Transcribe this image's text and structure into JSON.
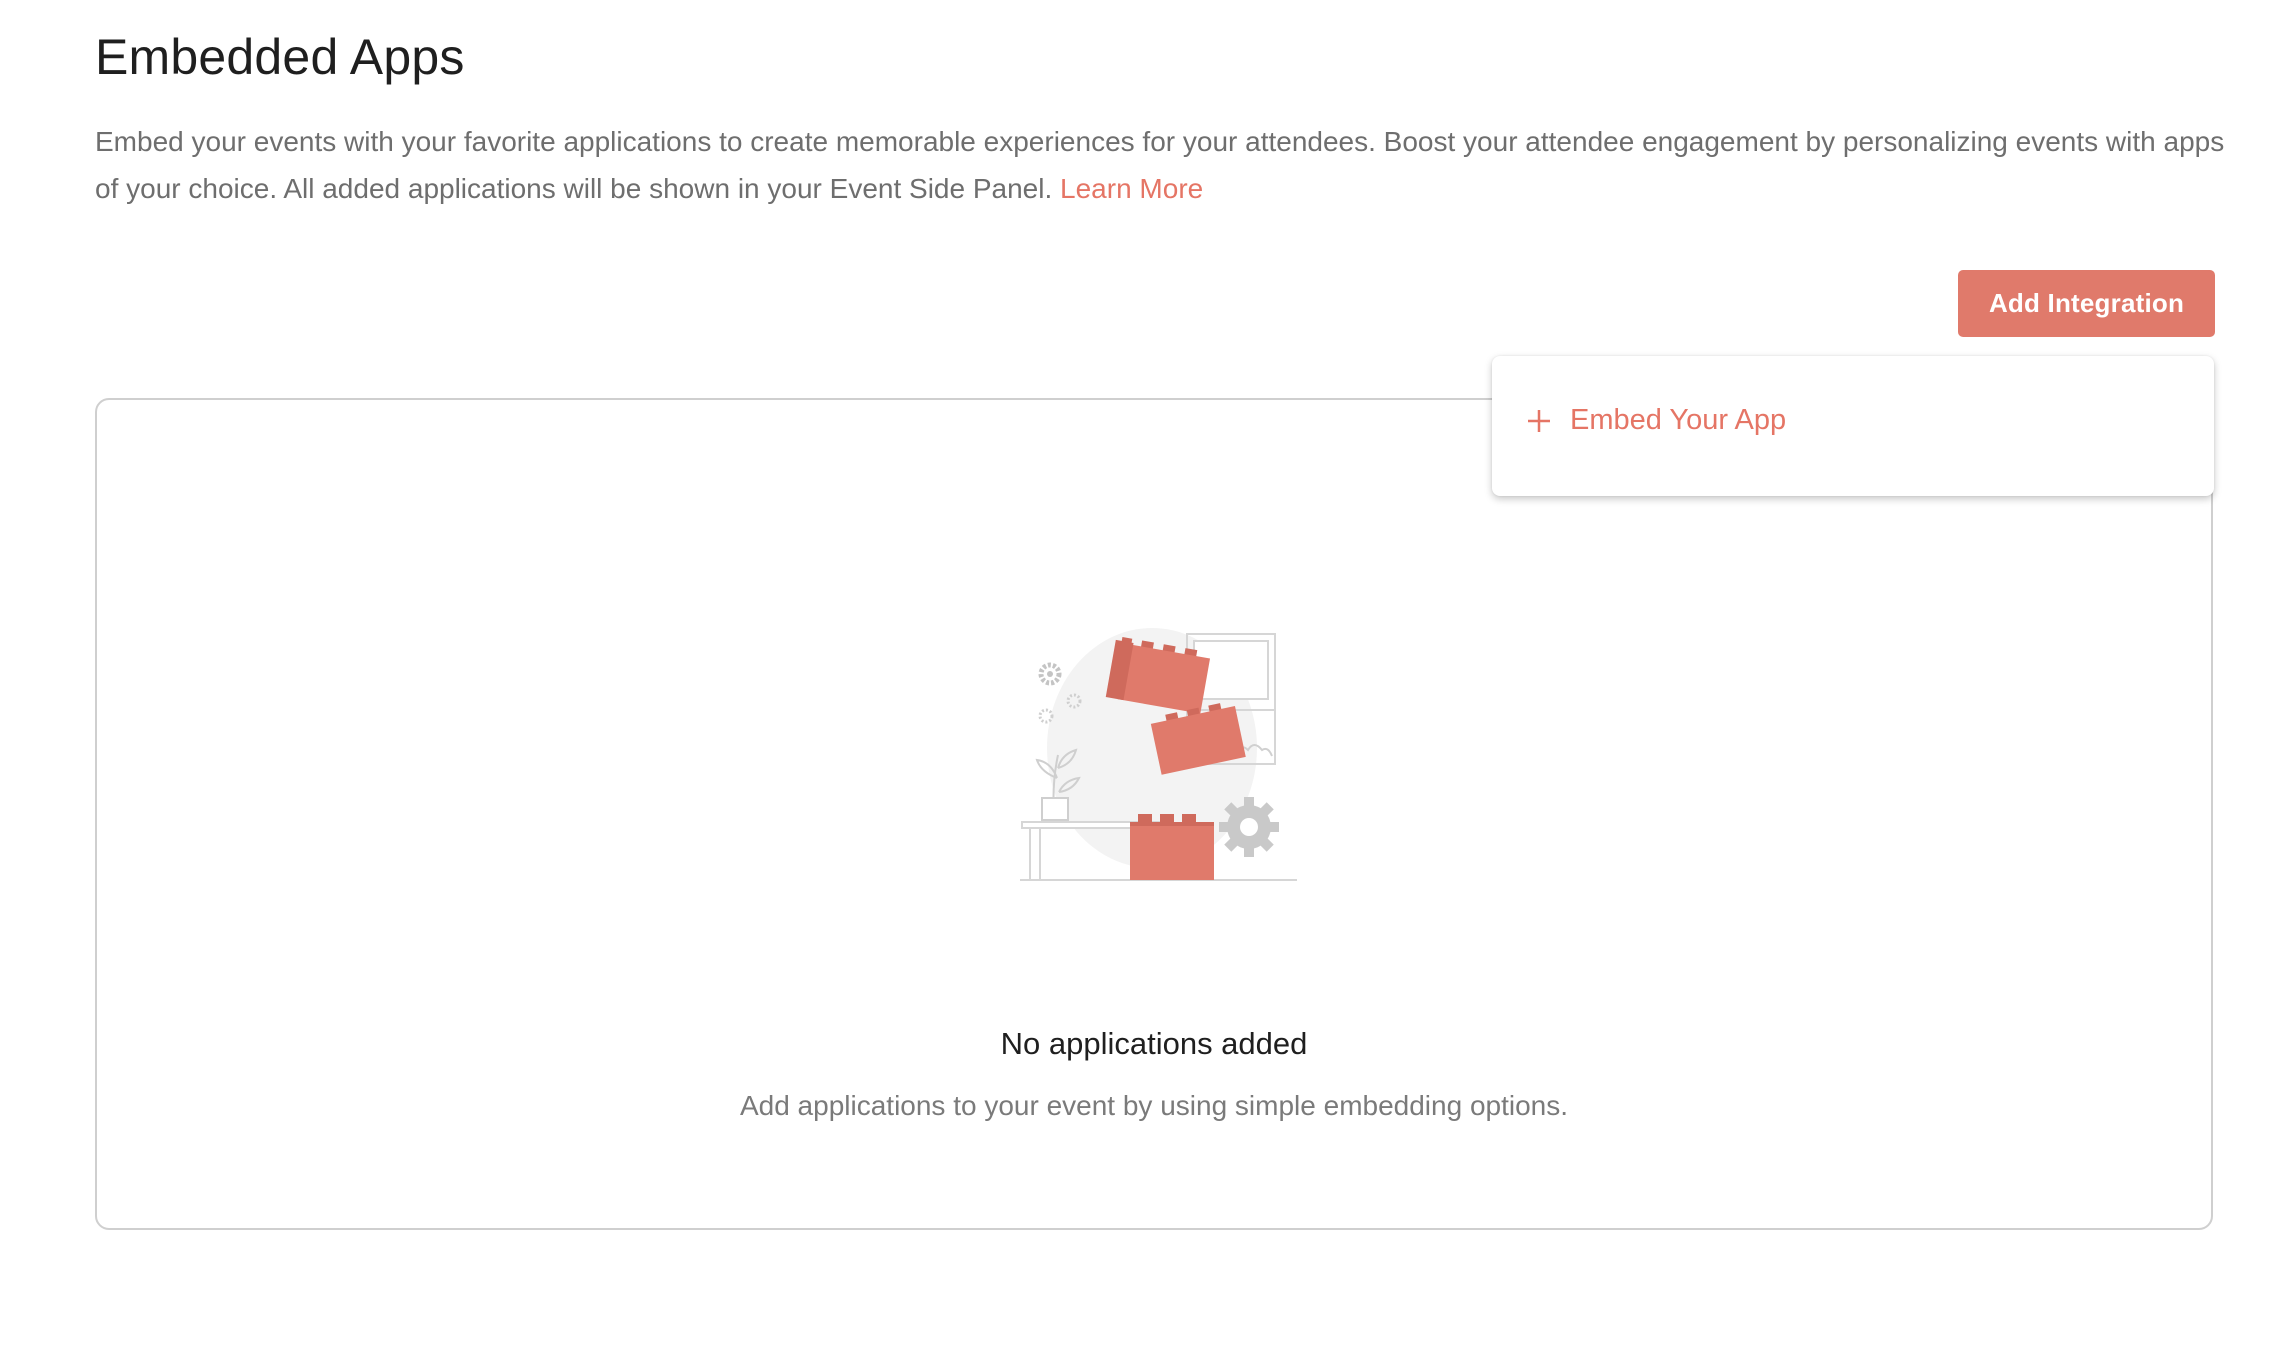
{
  "header": {
    "title": "Embedded Apps",
    "description": "Embed your events with your favorite applications to create memorable experiences for your attendees. Boost your attendee engagement by personalizing events with apps of your choice. All added applications will be shown in your Event Side Panel.",
    "learn_more_label": "Learn More"
  },
  "toolbar": {
    "add_integration_label": "Add Integration"
  },
  "dropdown": {
    "items": [
      {
        "label": "Embed Your App",
        "icon": "plus-icon"
      }
    ]
  },
  "empty_state": {
    "title": "No applications added",
    "subtitle": "Add applications to your event by using simple embedding options.",
    "illustration": "blocks-illustration"
  },
  "colors": {
    "accent": "#e07a6b",
    "link": "#e57565",
    "text_primary": "#1f1f1f",
    "text_secondary": "#6e6e6e",
    "border": "#cfcfcf"
  }
}
